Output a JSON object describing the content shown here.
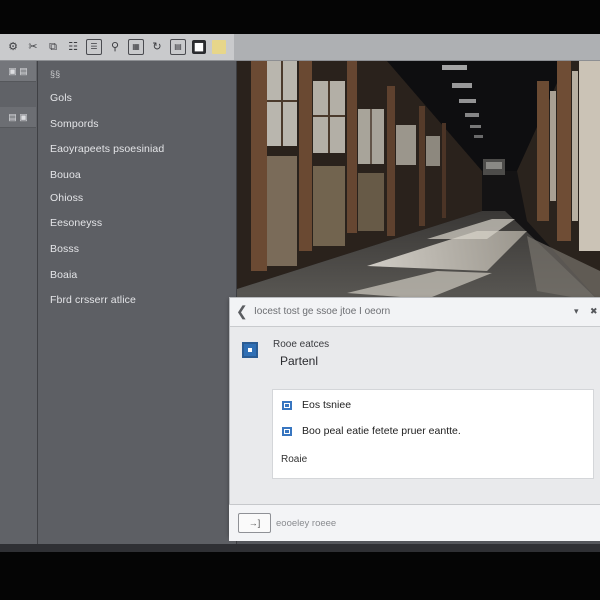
{
  "toolbar": {
    "icons": [
      "gear-icon",
      "scissors-icon",
      "copy-icon",
      "paste-icon",
      "list-icon",
      "tag-icon",
      "grid-icon",
      "refresh-icon",
      "photo-icon",
      "active-document-icon",
      "folder-icon"
    ]
  },
  "left_panel": {
    "tab1_label": "▣ ▤",
    "tab2_label": "▤ ▣"
  },
  "sidebar": {
    "header": "§§",
    "items": [
      {
        "label": "Gols"
      },
      {
        "label": "Sompords"
      },
      {
        "label": "Eaoyrapeets psoesiniad"
      },
      {
        "label": "Bouoa"
      },
      {
        "label": "Ohioss"
      },
      {
        "label": "Eesoneyss"
      },
      {
        "label": "Bosss"
      },
      {
        "label": "Boaia"
      },
      {
        "label": "Fbrd crsserr atlice"
      }
    ]
  },
  "dialog": {
    "title": "Iocest tost ge ssoe jtoe I oeorn",
    "caret": "▾",
    "close": "✖",
    "subtitle": "Rooe eatces",
    "heading": "Partenl",
    "options": [
      {
        "label": "Eos tsniee"
      },
      {
        "label": "Boo peal eatie fetete pruer eantte."
      }
    ],
    "footer": "Roaie"
  },
  "bottom_bar": {
    "button_glyph": "→]",
    "label": "eooeley roeee"
  },
  "colors": {
    "accent": "#2f6fb5",
    "sidebar_bg": "#5d5f64",
    "toolbar_bg": "#c9cacc",
    "dialog_bg": "#e9eaec"
  }
}
